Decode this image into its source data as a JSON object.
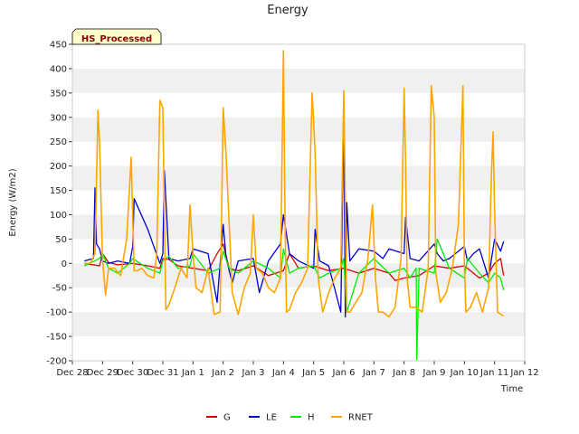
{
  "chart_data": {
    "type": "line",
    "title": "Energy",
    "xlabel": "Time",
    "ylabel": "Energy (W/m2)",
    "annotation": "HS_Processed",
    "ylim": [
      -200,
      450
    ],
    "yticks": [
      -200,
      -150,
      -100,
      -50,
      0,
      50,
      100,
      150,
      200,
      250,
      300,
      350,
      400,
      450
    ],
    "xlim": [
      0,
      15
    ],
    "xticks": [
      {
        "x": 0,
        "label": "Dec 28"
      },
      {
        "x": 1,
        "label": "Dec 29"
      },
      {
        "x": 2,
        "label": "Dec 30"
      },
      {
        "x": 3,
        "label": "Dec 31"
      },
      {
        "x": 4,
        "label": "Jan 1"
      },
      {
        "x": 5,
        "label": "Jan 2"
      },
      {
        "x": 6,
        "label": "Jan 3"
      },
      {
        "x": 7,
        "label": "Jan 4"
      },
      {
        "x": 8,
        "label": "Jan 5"
      },
      {
        "x": 9,
        "label": "Jan 6"
      },
      {
        "x": 10,
        "label": "Jan 7"
      },
      {
        "x": 11,
        "label": "Jan 8"
      },
      {
        "x": 12,
        "label": "Jan 9"
      },
      {
        "x": 13,
        "label": "Jan 10"
      },
      {
        "x": 14,
        "label": "Jan 11"
      },
      {
        "x": 15,
        "label": "Jan 12"
      }
    ],
    "grid": "horizontal bands",
    "legend_position": "bottom",
    "series": [
      {
        "name": "G",
        "color": "#dd0000",
        "x": [
          0.4,
          0.9,
          1.0,
          1.2,
          1.5,
          2.0,
          2.5,
          2.9,
          3.0,
          3.2,
          3.5,
          4.0,
          4.5,
          4.8,
          5.0,
          5.2,
          5.5,
          6.0,
          6.5,
          7.0,
          7.2,
          7.5,
          8.0,
          8.5,
          9.0,
          9.5,
          10.0,
          10.5,
          10.7,
          11.0,
          11.5,
          12.0,
          12.5,
          13.0,
          13.5,
          13.8,
          14.0,
          14.2,
          14.3
        ],
        "y": [
          0,
          -5,
          20,
          2,
          -3,
          0,
          -5,
          -10,
          10,
          8,
          -5,
          -10,
          -15,
          20,
          40,
          -10,
          -15,
          -5,
          -25,
          -15,
          20,
          -10,
          -5,
          -15,
          -10,
          -20,
          -10,
          -20,
          -35,
          -30,
          -25,
          -5,
          -10,
          -5,
          -30,
          -20,
          0,
          10,
          -25
        ]
      },
      {
        "name": "LE",
        "color": "#0000cc",
        "x": [
          0.4,
          0.7,
          0.75,
          0.8,
          0.9,
          1.0,
          1.2,
          1.5,
          1.9,
          2.0,
          2.05,
          2.5,
          2.9,
          3.0,
          3.05,
          3.2,
          3.5,
          3.9,
          4.0,
          4.5,
          4.8,
          5.0,
          5.1,
          5.3,
          5.5,
          6.0,
          6.2,
          6.5,
          6.9,
          7.0,
          7.2,
          7.5,
          8.0,
          8.05,
          8.2,
          8.5,
          8.9,
          9.0,
          9.05,
          9.1,
          9.2,
          9.5,
          10.0,
          10.3,
          10.5,
          11.0,
          11.05,
          11.2,
          11.5,
          12.0,
          12.1,
          12.3,
          12.5,
          13.0,
          13.1,
          13.3,
          13.5,
          13.8,
          14.0,
          14.2,
          14.3
        ],
        "y": [
          5,
          10,
          155,
          40,
          30,
          5,
          0,
          5,
          0,
          35,
          133,
          70,
          0,
          20,
          190,
          10,
          5,
          10,
          30,
          20,
          -80,
          80,
          10,
          -40,
          5,
          10,
          -60,
          5,
          40,
          100,
          20,
          5,
          -10,
          70,
          5,
          -5,
          -100,
          300,
          -110,
          125,
          5,
          30,
          25,
          10,
          30,
          20,
          95,
          10,
          5,
          40,
          20,
          5,
          10,
          35,
          5,
          20,
          30,
          -30,
          50,
          25,
          45
        ]
      },
      {
        "name": "H",
        "color": "#00ee00",
        "x": [
          0.4,
          0.9,
          1.0,
          1.2,
          1.5,
          1.9,
          2.0,
          2.5,
          2.9,
          3.0,
          3.2,
          3.5,
          3.9,
          4.0,
          4.5,
          4.9,
          5.0,
          5.2,
          5.5,
          6.0,
          6.5,
          6.9,
          7.0,
          7.2,
          7.5,
          8.0,
          8.2,
          8.5,
          8.9,
          9.0,
          9.1,
          9.5,
          10.0,
          10.5,
          11.0,
          11.2,
          11.4,
          11.42,
          11.5,
          12.0,
          12.1,
          12.5,
          13.0,
          13.1,
          13.5,
          13.8,
          14.0,
          14.2,
          14.3
        ],
        "y": [
          -5,
          10,
          20,
          -10,
          -20,
          0,
          10,
          -10,
          -20,
          5,
          15,
          -10,
          -5,
          20,
          -20,
          -10,
          25,
          -10,
          -20,
          5,
          -10,
          -30,
          30,
          -20,
          -10,
          -5,
          -30,
          -20,
          -10,
          10,
          -100,
          -20,
          10,
          -20,
          -10,
          -30,
          -10,
          -198,
          -10,
          -20,
          50,
          -10,
          -30,
          10,
          -20,
          -40,
          -20,
          -30,
          -55
        ]
      },
      {
        "name": "RNET",
        "color": "#ffa500",
        "x": [
          0.4,
          0.6,
          0.75,
          0.85,
          0.9,
          1.0,
          1.1,
          1.2,
          1.4,
          1.6,
          1.8,
          1.95,
          2.05,
          2.15,
          2.3,
          2.5,
          2.7,
          2.8,
          2.9,
          3.0,
          3.05,
          3.1,
          3.2,
          3.4,
          3.6,
          3.8,
          3.9,
          4.0,
          4.1,
          4.3,
          4.5,
          4.7,
          4.9,
          5.0,
          5.1,
          5.3,
          5.5,
          5.7,
          5.9,
          6.0,
          6.1,
          6.3,
          6.5,
          6.7,
          6.9,
          7.0,
          7.05,
          7.1,
          7.2,
          7.4,
          7.6,
          7.8,
          7.95,
          8.05,
          8.15,
          8.3,
          8.5,
          8.7,
          8.9,
          9.0,
          9.1,
          9.2,
          9.4,
          9.6,
          9.8,
          9.95,
          10.05,
          10.15,
          10.3,
          10.5,
          10.7,
          10.9,
          11.0,
          11.05,
          11.1,
          11.2,
          11.4,
          11.6,
          11.8,
          11.9,
          12.0,
          12.05,
          12.2,
          12.4,
          12.6,
          12.8,
          12.95,
          13.0,
          13.05,
          13.2,
          13.4,
          13.6,
          13.8,
          13.9,
          13.95,
          14.0,
          14.1,
          14.3
        ],
        "y": [
          0,
          0,
          20,
          315,
          250,
          10,
          -65,
          -10,
          -10,
          -25,
          50,
          218,
          -15,
          -15,
          -10,
          -25,
          -30,
          20,
          335,
          320,
          100,
          -95,
          -85,
          -50,
          -10,
          -30,
          120,
          20,
          -50,
          -60,
          -10,
          -105,
          -100,
          320,
          220,
          -60,
          -105,
          -50,
          -20,
          100,
          -10,
          -20,
          -50,
          -60,
          -30,
          437,
          100,
          -100,
          -95,
          -60,
          -40,
          -10,
          350,
          230,
          -30,
          -100,
          -60,
          -30,
          -10,
          355,
          -100,
          -100,
          -80,
          -60,
          10,
          120,
          -30,
          -100,
          -100,
          -110,
          -90,
          10,
          360,
          210,
          -30,
          -90,
          -90,
          -100,
          -10,
          365,
          300,
          -20,
          -80,
          -60,
          -10,
          80,
          365,
          0,
          -100,
          -90,
          -60,
          -100,
          -50,
          190,
          270,
          110,
          -100,
          -108
        ]
      }
    ]
  }
}
